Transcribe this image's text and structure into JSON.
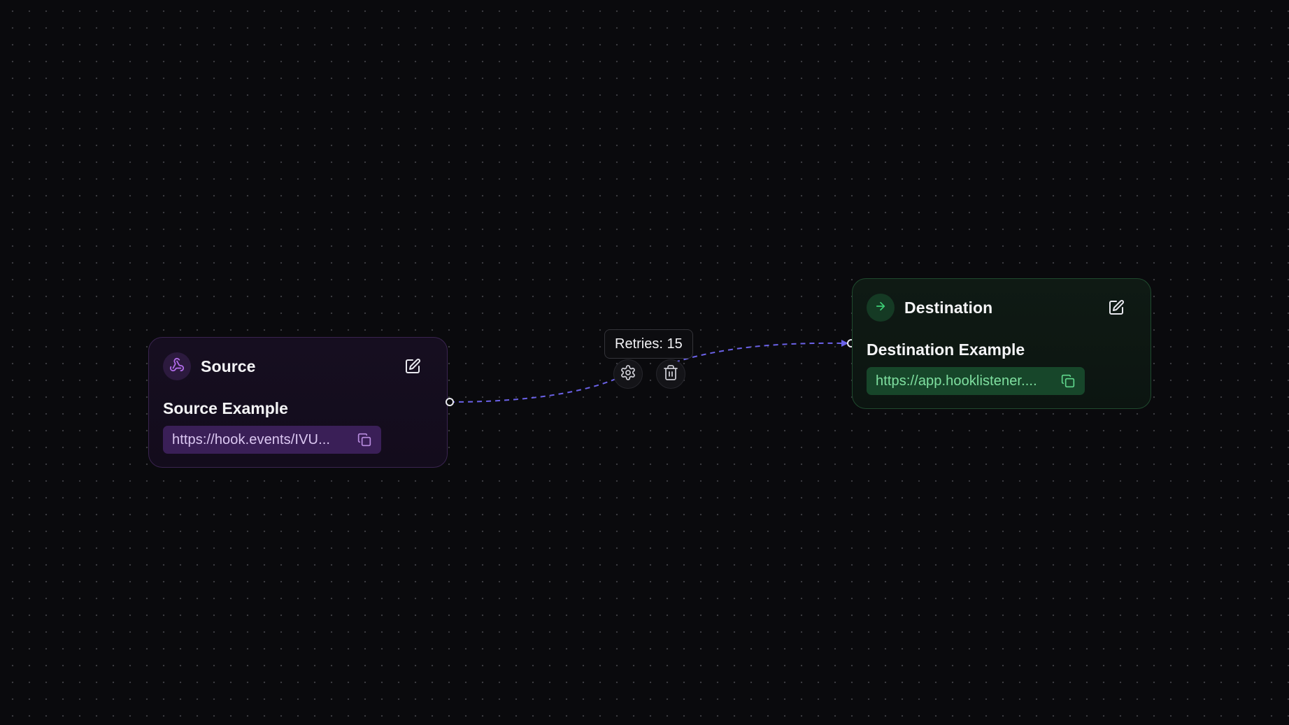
{
  "canvas": {
    "background": "#0a0a0d",
    "dot_color": "#3a3a40"
  },
  "source_node": {
    "type_label": "Source",
    "name": "Source Example",
    "url": "https://hook.events/IVU...",
    "icon": "webhook-icon",
    "accent": "#b06be8",
    "edit_icon": "edit-icon",
    "copy_icon": "copy-icon"
  },
  "destination_node": {
    "type_label": "Destination",
    "name": "Destination Example",
    "url": "https://app.hooklistener....",
    "icon": "arrow-right-icon",
    "accent": "#3ccf74",
    "edit_icon": "edit-icon",
    "copy_icon": "copy-icon"
  },
  "connection": {
    "label": "Retries: 15",
    "line_color": "#6b62e8",
    "settings_icon": "gear-icon",
    "delete_icon": "trash-icon"
  }
}
